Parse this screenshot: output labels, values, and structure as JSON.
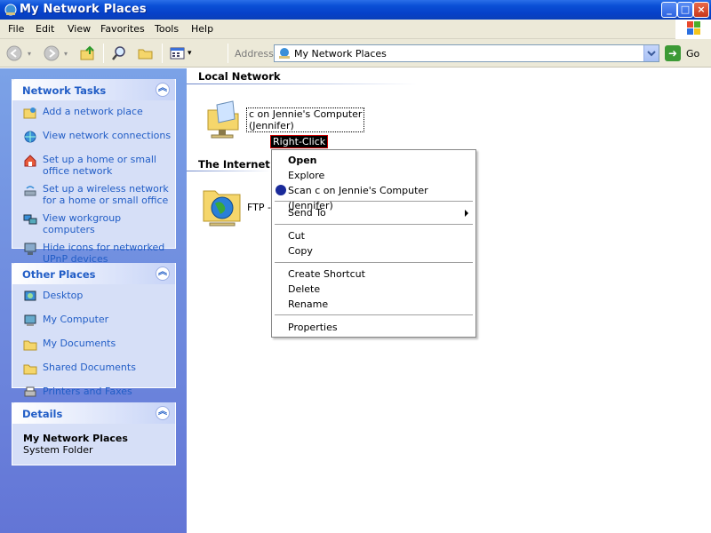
{
  "window": {
    "title": "My Network Places"
  },
  "menu": [
    "File",
    "Edit",
    "View",
    "Favorites",
    "Tools",
    "Help"
  ],
  "title_buttons": {
    "minimize": "_",
    "maximize": "□",
    "close": "×"
  },
  "address": {
    "label": "Address",
    "value": "My Network Places",
    "go_label": "Go"
  },
  "panels": {
    "network_tasks": {
      "title": "Network Tasks",
      "items": [
        "Add a network place",
        "View network connections",
        "Set up a home or small office network",
        "Set up a wireless network for a home or small office",
        "View workgroup computers",
        "Hide icons for networked UPnP devices"
      ]
    },
    "other_places": {
      "title": "Other Places",
      "items": [
        "Desktop",
        "My Computer",
        "My Documents",
        "Shared Documents",
        "Printers and Faxes"
      ]
    },
    "details": {
      "title": "Details",
      "name": "My Network Places",
      "type": "System Folder"
    }
  },
  "content": {
    "local_network": {
      "header": "Local Network",
      "item_line1": "c on Jennie's Computer",
      "item_line2": "(Jennifer)"
    },
    "internet": {
      "header": "The Internet",
      "item_label": "FTP -"
    }
  },
  "annotation": "Right-Click",
  "context_menu": {
    "open": "Open",
    "explore": "Explore",
    "scan": "Scan c on Jennie's Computer (Jennifer)",
    "send_to": "Send To",
    "cut": "Cut",
    "copy": "Copy",
    "create_shortcut": "Create Shortcut",
    "delete": "Delete",
    "rename": "Rename",
    "properties": "Properties"
  },
  "colors": {
    "title_bar": "#0a4fd6",
    "task_pane": "#6d8ce0",
    "panel_title": "#215dc6",
    "chrome": "#ece9d8"
  }
}
